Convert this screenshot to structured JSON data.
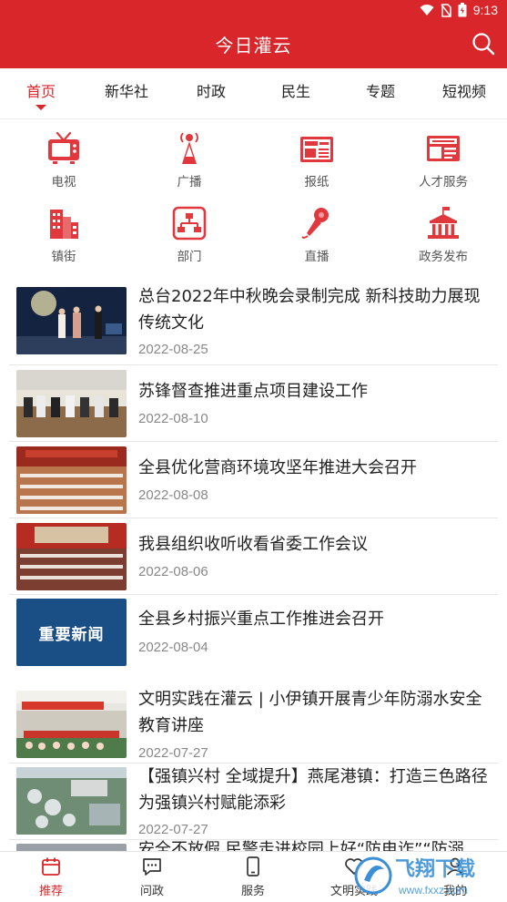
{
  "status": {
    "time": "9:13"
  },
  "header": {
    "title": "今日灌云"
  },
  "tabs": [
    {
      "label": "首页"
    },
    {
      "label": "新华社"
    },
    {
      "label": "时政"
    },
    {
      "label": "民生"
    },
    {
      "label": "专题"
    },
    {
      "label": "短视频"
    }
  ],
  "grid": [
    {
      "label": "电视",
      "icon": "tv-icon"
    },
    {
      "label": "广播",
      "icon": "radio-tower-icon"
    },
    {
      "label": "报纸",
      "icon": "newspaper-icon"
    },
    {
      "label": "人才服务",
      "icon": "press-card-icon"
    },
    {
      "label": "镇街",
      "icon": "buildings-icon"
    },
    {
      "label": "部门",
      "icon": "org-chart-icon"
    },
    {
      "label": "直播",
      "icon": "microphone-icon"
    },
    {
      "label": "政务发布",
      "icon": "government-building-icon"
    }
  ],
  "news": [
    {
      "title": "总台2022年中秋晚会录制完成 新科技助力展现传统文化",
      "date": "2022-08-25"
    },
    {
      "title": "苏锋督查推进重点项目建设工作",
      "date": "2022-08-10"
    },
    {
      "title": "全县优化营商环境攻坚年推进大会召开",
      "date": "2022-08-08"
    },
    {
      "title": "我县组织收听收看省委工作会议",
      "date": "2022-08-06"
    },
    {
      "title": "全县乡村振兴重点工作推进会召开",
      "date": "2022-08-04",
      "thumb_text": "重要新闻"
    },
    {
      "title": "文明实践在灌云 | 小伊镇开展青少年防溺水安全教育讲座",
      "date": "2022-07-27"
    },
    {
      "title": "【强镇兴村 全域提升】燕尾港镇：打造三色路径 为强镇兴村赋能添彩",
      "date": "2022-07-27"
    },
    {
      "title": "安全不放假 民警走进校园上好“防电诈”“防溺",
      "date": ""
    }
  ],
  "bottom_nav": [
    {
      "label": "推荐"
    },
    {
      "label": "问政"
    },
    {
      "label": "服务"
    },
    {
      "label": "文明实践"
    },
    {
      "label": "我的"
    }
  ],
  "watermark": {
    "text": "飞翔下载",
    "url_text": "www.fxxz.com"
  },
  "colors": {
    "brand": "#d8262a",
    "text": "#222222",
    "muted": "#888888"
  }
}
